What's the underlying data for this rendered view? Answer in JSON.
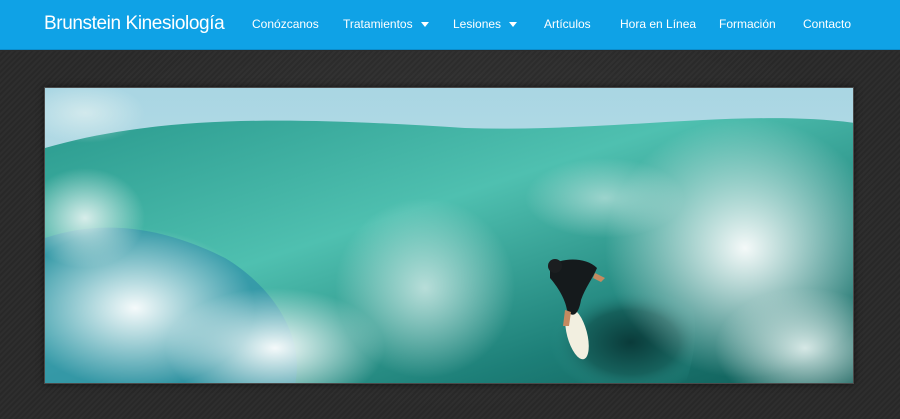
{
  "header": {
    "brand": "Brunstein Kinesiología",
    "nav": [
      {
        "label": "Conózcanos",
        "dropdown": false
      },
      {
        "label": "Tratamientos",
        "dropdown": true
      },
      {
        "label": "Lesiones",
        "dropdown": true
      },
      {
        "label": "Artículos",
        "dropdown": false
      },
      {
        "label": "Hora en Línea",
        "dropdown": false
      },
      {
        "label": "Formación",
        "dropdown": false
      },
      {
        "label": "Contacto",
        "dropdown": false
      }
    ]
  },
  "hero": {
    "image": "surfer-inside-breaking-wave"
  },
  "colors": {
    "navbar": "#0fa2e6",
    "page_background": "#2b2b2b",
    "nav_text": "#ffffff"
  }
}
